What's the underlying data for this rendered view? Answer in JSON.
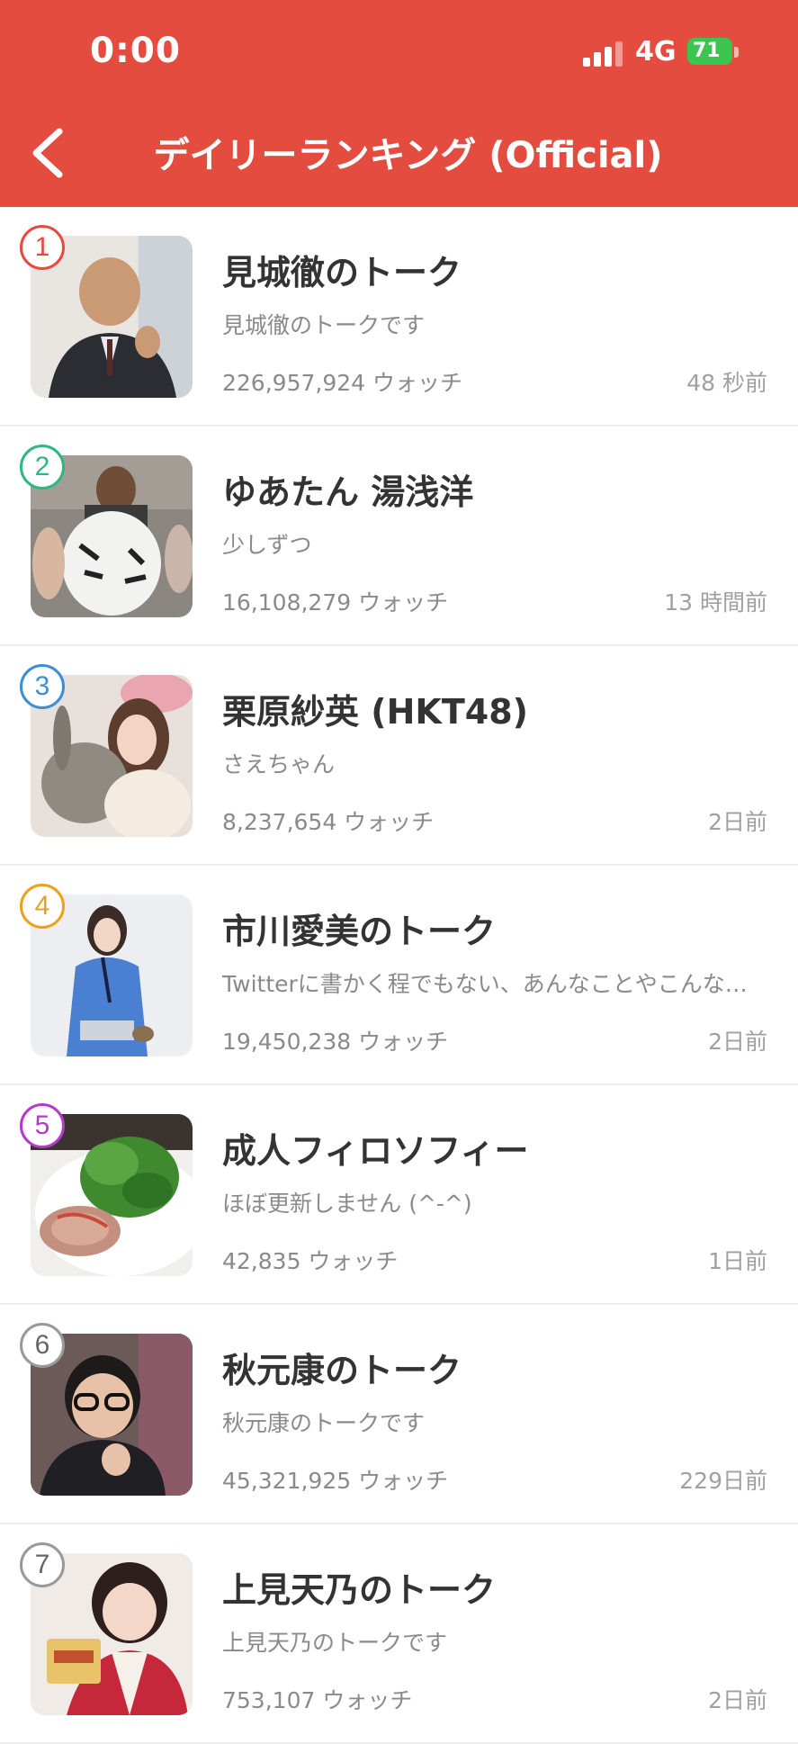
{
  "status_bar": {
    "time": "0:00",
    "network": "4G",
    "battery": "71"
  },
  "header": {
    "title": "デイリーランキング (Official)"
  },
  "items": [
    {
      "rank": "1",
      "rank_color": "#e54a3d",
      "title": "見城徹のトーク",
      "desc": "見城徹のトークです",
      "watch": "226,957,924 ウォッチ",
      "time": "48 秒前"
    },
    {
      "rank": "2",
      "rank_color": "#2fb783",
      "title": "ゆあたん 湯浅洋",
      "desc": "少しずつ",
      "watch": "16,108,279 ウォッチ",
      "time": "13 時間前"
    },
    {
      "rank": "3",
      "rank_color": "#3c8fd6",
      "title": "栗原紗英 (HKT48)",
      "desc": "さえちゃん",
      "watch": "8,237,654 ウォッチ",
      "time": "2日前"
    },
    {
      "rank": "4",
      "rank_color": "#e8a21b",
      "title": "市川愛美のトーク",
      "desc": "Twitterに書かく程でもない、あんなことやこんなこと",
      "watch": "19,450,238 ウォッチ",
      "time": "2日前"
    },
    {
      "rank": "5",
      "rank_color": "#b43bc9",
      "title": "成人フィロソフィー",
      "desc": "ほぼ更新しません (^-^)",
      "watch": "42,835 ウォッチ",
      "time": "1日前"
    },
    {
      "rank": "6",
      "rank_color": "#999999",
      "title": "秋元康のトーク",
      "desc": "秋元康のトークです",
      "watch": "45,321,925 ウォッチ",
      "time": "229日前"
    },
    {
      "rank": "7",
      "rank_color": "#999999",
      "title": "上見天乃のトーク",
      "desc": "上見天乃のトークです",
      "watch": "753,107 ウォッチ",
      "time": "2日前"
    }
  ]
}
